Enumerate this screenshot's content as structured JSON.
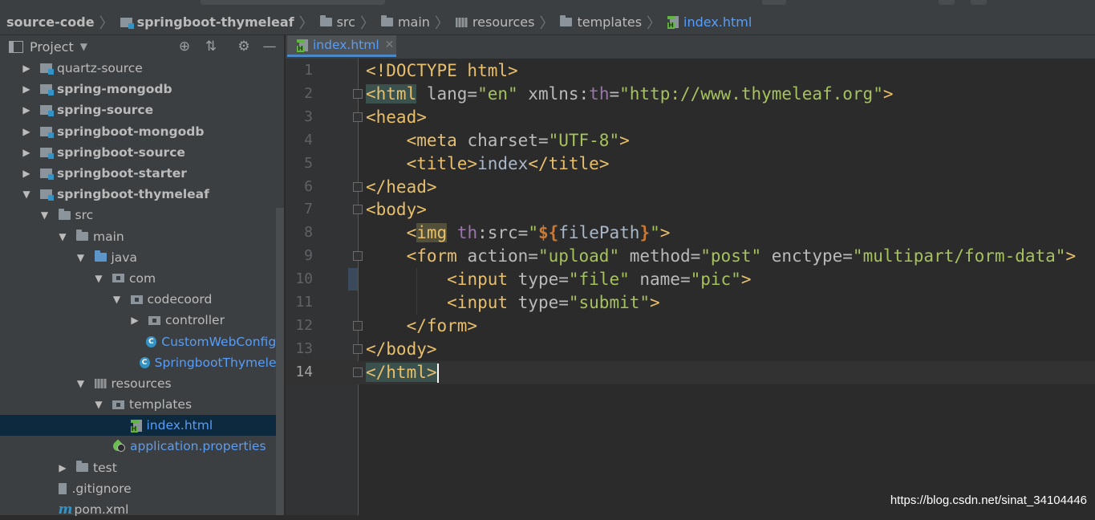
{
  "breadcrumb": {
    "items": [
      {
        "label": "source-code",
        "icon": "none",
        "bold": true
      },
      {
        "label": "springboot-thymeleaf",
        "icon": "module-icon",
        "bold": true
      },
      {
        "label": "src",
        "icon": "folder-icon"
      },
      {
        "label": "main",
        "icon": "folder-icon"
      },
      {
        "label": "resources",
        "icon": "resources-folder-icon"
      },
      {
        "label": "templates",
        "icon": "folder-icon"
      },
      {
        "label": "index.html",
        "icon": "html-file-icon",
        "active": true
      }
    ]
  },
  "project_panel": {
    "title": "Project",
    "tree": [
      {
        "label": "quartz-source",
        "depth": 0,
        "expanded": false,
        "icon": "module-icon",
        "bold": false
      },
      {
        "label": "spring-mongodb",
        "depth": 0,
        "expanded": false,
        "icon": "module-icon",
        "bold": true
      },
      {
        "label": "spring-source",
        "depth": 0,
        "expanded": false,
        "icon": "module-icon",
        "bold": true
      },
      {
        "label": "springboot-mongodb",
        "depth": 0,
        "expanded": false,
        "icon": "module-icon",
        "bold": true
      },
      {
        "label": "springboot-source",
        "depth": 0,
        "expanded": false,
        "icon": "module-icon",
        "bold": true
      },
      {
        "label": "springboot-starter",
        "depth": 0,
        "expanded": false,
        "icon": "module-icon",
        "bold": true
      },
      {
        "label": "springboot-thymeleaf",
        "depth": 0,
        "expanded": true,
        "icon": "module-icon",
        "bold": true
      },
      {
        "label": "src",
        "depth": 1,
        "expanded": true,
        "icon": "folder-icon"
      },
      {
        "label": "main",
        "depth": 2,
        "expanded": true,
        "icon": "folder-icon"
      },
      {
        "label": "java",
        "depth": 3,
        "expanded": true,
        "icon": "source-folder-icon"
      },
      {
        "label": "com",
        "depth": 4,
        "expanded": true,
        "icon": "package-icon"
      },
      {
        "label": "codecoord",
        "depth": 5,
        "expanded": true,
        "icon": "package-icon"
      },
      {
        "label": "controller",
        "depth": 6,
        "expanded": false,
        "icon": "package-icon"
      },
      {
        "label": "CustomWebConfigu",
        "depth": 6,
        "leaf": true,
        "icon": "class-icon",
        "color": "blue"
      },
      {
        "label": "SpringbootThymelea",
        "depth": 6,
        "leaf": true,
        "icon": "spring-boot-class-icon",
        "color": "blue"
      },
      {
        "label": "resources",
        "depth": 3,
        "expanded": true,
        "icon": "resources-folder-icon"
      },
      {
        "label": "templates",
        "depth": 4,
        "expanded": true,
        "icon": "package-icon"
      },
      {
        "label": "index.html",
        "depth": 5,
        "leaf": true,
        "icon": "html-file-icon",
        "selected": true,
        "color": "blue"
      },
      {
        "label": "application.properties",
        "depth": 4,
        "leaf": true,
        "icon": "spring-properties-icon",
        "color": "blue"
      },
      {
        "label": "test",
        "depth": 2,
        "expanded": false,
        "icon": "folder-icon"
      },
      {
        "label": ".gitignore",
        "depth": 1,
        "leaf": true,
        "icon": "gitignore-file-icon"
      },
      {
        "label": "pom.xml",
        "depth": 1,
        "leaf": true,
        "icon": "maven-file-icon"
      }
    ]
  },
  "editor": {
    "tab_label": "index.html",
    "current_line": 14,
    "lines": [
      {
        "n": "1",
        "tokens": [
          [
            "doc",
            "<!DOCTYPE html>"
          ]
        ]
      },
      {
        "n": "2",
        "tokens": [
          [
            "tag hl-tag",
            "<html"
          ],
          [
            "attr",
            " lang="
          ],
          [
            "str",
            "\"en\""
          ],
          [
            "attr",
            " xmlns:"
          ],
          [
            "ns",
            "th"
          ],
          [
            "attr",
            "="
          ],
          [
            "str",
            "\"http://www.thymeleaf.org\""
          ],
          [
            "tag",
            ">"
          ]
        ]
      },
      {
        "n": "3",
        "tokens": [
          [
            "tag",
            "<head>"
          ]
        ]
      },
      {
        "n": "4",
        "tokens": [
          [
            "pl",
            "    "
          ],
          [
            "tag",
            "<meta"
          ],
          [
            "attr",
            " charset="
          ],
          [
            "str",
            "\"UTF-8\""
          ],
          [
            "tag",
            ">"
          ]
        ]
      },
      {
        "n": "5",
        "tokens": [
          [
            "pl",
            "    "
          ],
          [
            "tag",
            "<title>"
          ],
          [
            "pl",
            "index"
          ],
          [
            "tag",
            "</title>"
          ]
        ]
      },
      {
        "n": "6",
        "tokens": [
          [
            "tag",
            "</head>"
          ]
        ]
      },
      {
        "n": "7",
        "tokens": [
          [
            "tag",
            "<body>"
          ]
        ]
      },
      {
        "n": "8",
        "tokens": [
          [
            "pl",
            "    "
          ],
          [
            "tag",
            "<"
          ],
          [
            "tag hl-img",
            "img"
          ],
          [
            "ns",
            " th"
          ],
          [
            "attr",
            ":src="
          ],
          [
            "str",
            "\""
          ],
          [
            "exp",
            "${"
          ],
          [
            "var",
            "filePath"
          ],
          [
            "exp",
            "}"
          ],
          [
            "str",
            "\""
          ],
          [
            "tag",
            ">"
          ]
        ]
      },
      {
        "n": "9",
        "tokens": [
          [
            "pl",
            "    "
          ],
          [
            "tag",
            "<form"
          ],
          [
            "attr",
            " action="
          ],
          [
            "str",
            "\"upload\""
          ],
          [
            "attr",
            " method="
          ],
          [
            "str",
            "\"post\""
          ],
          [
            "attr",
            " enctype="
          ],
          [
            "str",
            "\"multipart/form-data\""
          ],
          [
            "tag",
            ">"
          ]
        ]
      },
      {
        "n": "10",
        "tokens": [
          [
            "pl",
            "        "
          ],
          [
            "tag",
            "<input"
          ],
          [
            "attr",
            " type="
          ],
          [
            "str",
            "\"file\""
          ],
          [
            "attr",
            " name="
          ],
          [
            "str",
            "\"pic\""
          ],
          [
            "tag",
            ">"
          ]
        ]
      },
      {
        "n": "11",
        "tokens": [
          [
            "pl",
            "        "
          ],
          [
            "tag",
            "<input"
          ],
          [
            "attr",
            " type="
          ],
          [
            "str",
            "\"submit\""
          ],
          [
            "tag",
            ">"
          ]
        ]
      },
      {
        "n": "12",
        "tokens": [
          [
            "pl",
            "    "
          ],
          [
            "tag",
            "</form>"
          ]
        ]
      },
      {
        "n": "13",
        "tokens": [
          [
            "tag",
            "</body>"
          ]
        ]
      },
      {
        "n": "14",
        "tokens": [
          [
            "tag hl-tag",
            "</html"
          ],
          [
            "tag hl-tag",
            ">"
          ]
        ]
      }
    ]
  },
  "watermark": "https://blog.csdn.net/sinat_34104446"
}
